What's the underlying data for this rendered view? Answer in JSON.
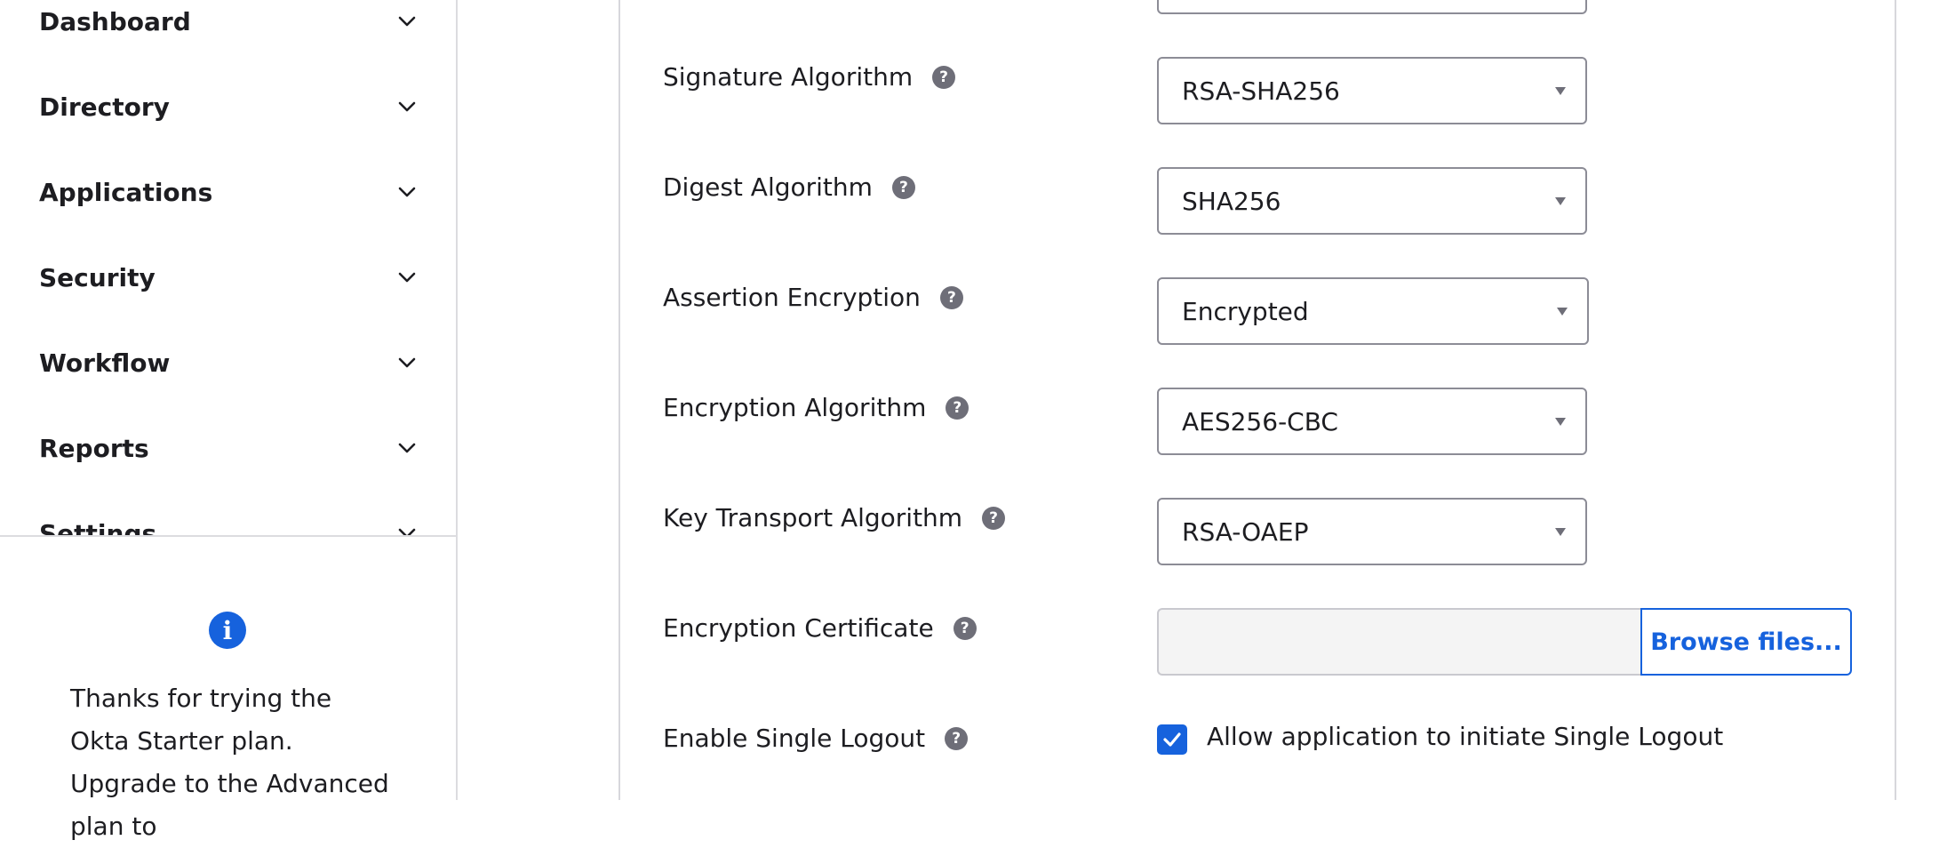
{
  "sidebar": {
    "nav_items": [
      {
        "label": "Dashboard"
      },
      {
        "label": "Directory"
      },
      {
        "label": "Applications"
      },
      {
        "label": "Security"
      },
      {
        "label": "Workflow"
      },
      {
        "label": "Reports"
      },
      {
        "label": "Settings"
      }
    ],
    "upgrade_message": "Thanks for trying the Okta Starter plan. Upgrade to the Advanced plan to"
  },
  "form": {
    "signature_algorithm": {
      "label": "Signature Algorithm",
      "value": "RSA-SHA256"
    },
    "digest_algorithm": {
      "label": "Digest Algorithm",
      "value": "SHA256"
    },
    "assertion_encryption": {
      "label": "Assertion Encryption",
      "value": "Encrypted"
    },
    "encryption_algorithm": {
      "label": "Encryption Algorithm",
      "value": "AES256-CBC"
    },
    "key_transport_algorithm": {
      "label": "Key Transport Algorithm",
      "value": "RSA-OAEP"
    },
    "encryption_certificate": {
      "label": "Encryption Certificate",
      "button_label": "Browse files..."
    },
    "single_logout": {
      "label": "Enable Single Logout",
      "checkbox_label": "Allow application to initiate Single Logout",
      "checked": true
    }
  },
  "colors": {
    "accent": "#1662dd",
    "help_icon": "#6e6e78",
    "border": "#8c8c96"
  },
  "icons": {
    "nav_chevron": "chevron-down-icon",
    "info": "info-icon",
    "help": "help-icon",
    "check": "check-icon"
  }
}
